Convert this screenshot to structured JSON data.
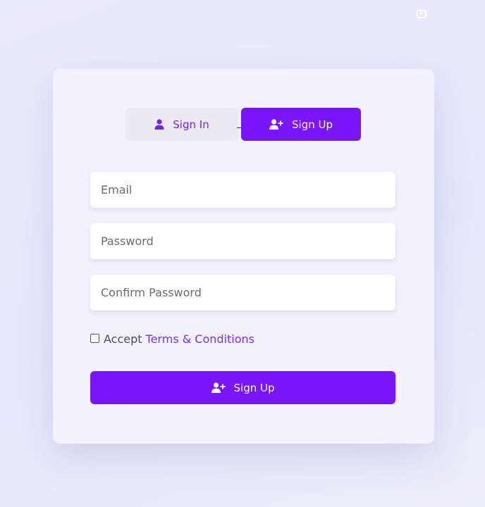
{
  "colors": {
    "accent": "#7a14fa",
    "accent_text": "#7521f2",
    "card_bg": "#f4f2fe",
    "inactive_tab_bg": "#eceaf2"
  },
  "tabs": {
    "signin_label": "Sign In",
    "signin_icon": "user-icon",
    "signup_label": "Sign Up",
    "signup_icon": "user-plus-icon",
    "active": "Sign Up"
  },
  "form": {
    "email_placeholder": "Email",
    "password_placeholder": "Password",
    "confirm_placeholder": "Confirm Password",
    "accept_label": "Accept",
    "terms_link": "Terms & Conditions",
    "accept_checked": false
  },
  "submit": {
    "label": "Sign Up",
    "icon": "user-plus-icon"
  }
}
